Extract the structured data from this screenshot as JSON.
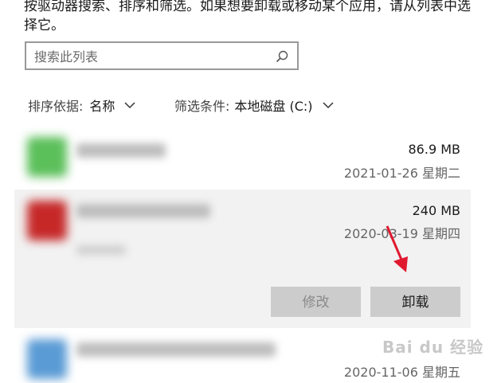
{
  "intro_text": "按驱动器搜索、排序和筛选。如果想要卸载或移动某个应用，请从列表中选择它。",
  "search": {
    "placeholder": "搜索此列表"
  },
  "sort": {
    "label": "排序依据:",
    "value": "名称"
  },
  "filter": {
    "label": "筛选条件:",
    "value": "本地磁盘 (C:)"
  },
  "apps": [
    {
      "size": "86.9 MB",
      "date": "2021-01-26 星期二",
      "icon_color": "#4caf50"
    },
    {
      "size": "240 MB",
      "date": "2020-03-19 星期四",
      "icon_color": "#d32f2f",
      "selected": true
    },
    {
      "size": "",
      "date": "2020-11-06 星期五",
      "icon_color": "#4a90c8"
    }
  ],
  "buttons": {
    "modify": "修改",
    "uninstall": "卸载"
  },
  "watermark": "Bai du 经验",
  "colors": {
    "arrow": "#e0192f"
  }
}
